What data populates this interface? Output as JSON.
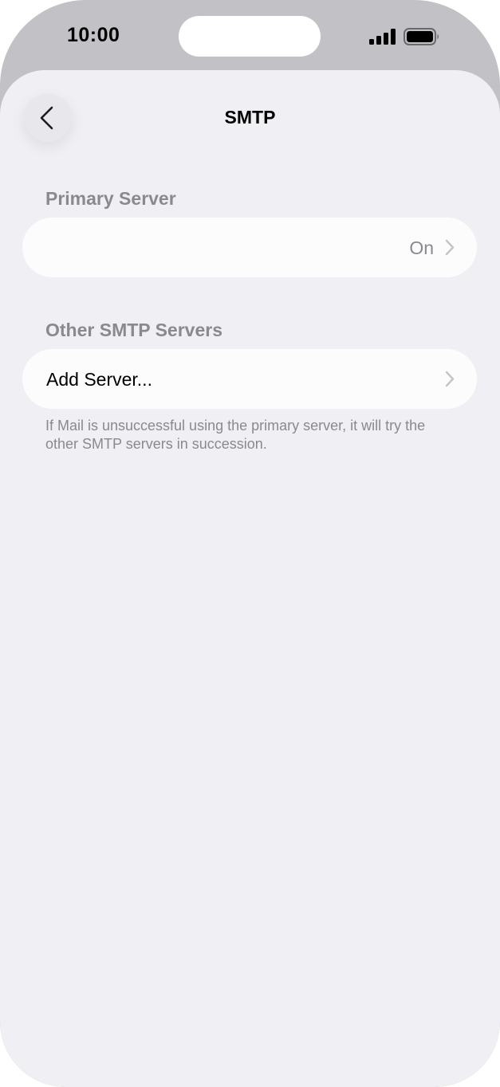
{
  "status_bar": {
    "time": "10:00",
    "signal_icon": "cellular-signal-icon",
    "battery_icon": "battery-full-icon"
  },
  "nav": {
    "title": "SMTP",
    "back_icon": "chevron-left-icon"
  },
  "primary_server": {
    "header": "Primary Server",
    "value": "On"
  },
  "other_servers": {
    "header": "Other SMTP Servers",
    "add_label": "Add Server..."
  },
  "footer_note": "If Mail is unsuccessful using the primary server, it will try the other SMTP servers in succession.",
  "colors": {
    "background": "#f0eff4",
    "card": "#fcfcfd",
    "secondary_text": "#8a8a8e",
    "chevron": "#c4c4c7"
  }
}
